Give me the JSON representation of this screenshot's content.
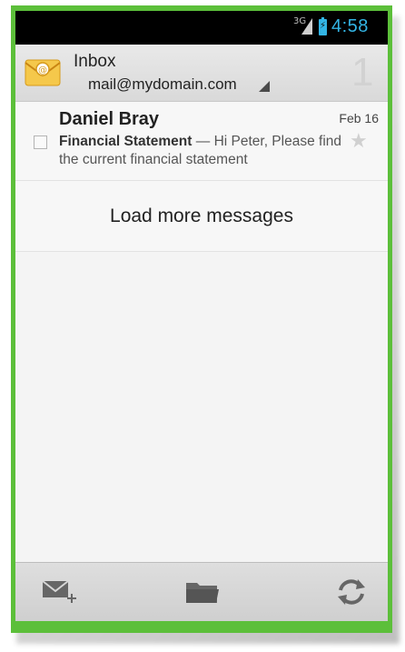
{
  "status_bar": {
    "network": "3G",
    "time": "4:58"
  },
  "header": {
    "title": "Inbox",
    "account": "mail@mydomain.com",
    "unread_count": "1"
  },
  "messages": [
    {
      "sender": "Daniel Bray",
      "date": "Feb 16",
      "subject": "Financial Statement",
      "separator": " — ",
      "snippet": "Hi Peter, Please find the current financial statement",
      "starred": false
    }
  ],
  "load_more_label": "Load more messages",
  "action_bar": {
    "icons": [
      "compose-icon",
      "folder-icon",
      "refresh-icon"
    ]
  },
  "colors": {
    "frame": "#5cbf3a",
    "status_accent": "#33b5e5"
  }
}
